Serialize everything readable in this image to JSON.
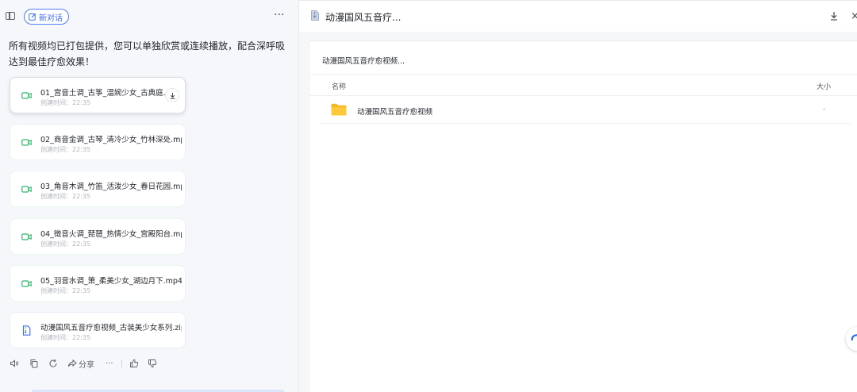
{
  "left": {
    "new_chat_label": "新对话",
    "more_label": "···",
    "intro_text": "所有视频均已打包提供，您可以单独欣赏或连续播放，配合深呼吸达到最佳疗愈效果！",
    "files": [
      {
        "name": "01_宫音土调_古筝_温婉少女_古典庭...",
        "created": "创建时间：22:35",
        "kind": "video"
      },
      {
        "name": "02_商音金调_古琴_清冷少女_竹林深处.mp4",
        "created": "创建时间：22:35",
        "kind": "video"
      },
      {
        "name": "03_角音木调_竹笛_活泼少女_春日花园.mp4",
        "created": "创建时间：22:35",
        "kind": "video"
      },
      {
        "name": "04_徵音火调_琵琶_热情少女_宫殿阳台.mp4",
        "created": "创建时间：22:35",
        "kind": "video"
      },
      {
        "name": "05_羽音水调_箫_柔美少女_湖边月下.mp4",
        "created": "创建时间：22:35",
        "kind": "video"
      },
      {
        "name": "动漫国风五音疗愈视频_古装美少女系列.zip",
        "created": "创建时间：22:35",
        "kind": "zip"
      }
    ],
    "actions": {
      "share_label": "分享",
      "more_label": "···"
    }
  },
  "right": {
    "header_title": "动漫国风五音疗...",
    "close_label": "×",
    "panel_title": "动漫国风五音疗愈视频...",
    "columns": {
      "name": "名称",
      "size": "大小"
    },
    "rows": [
      {
        "name": "动漫国风五音疗愈视频",
        "size": "-"
      }
    ]
  },
  "colors": {
    "accent": "#3b6cf5",
    "video_icon": "#2fb86b",
    "folder": "#f5b820"
  }
}
